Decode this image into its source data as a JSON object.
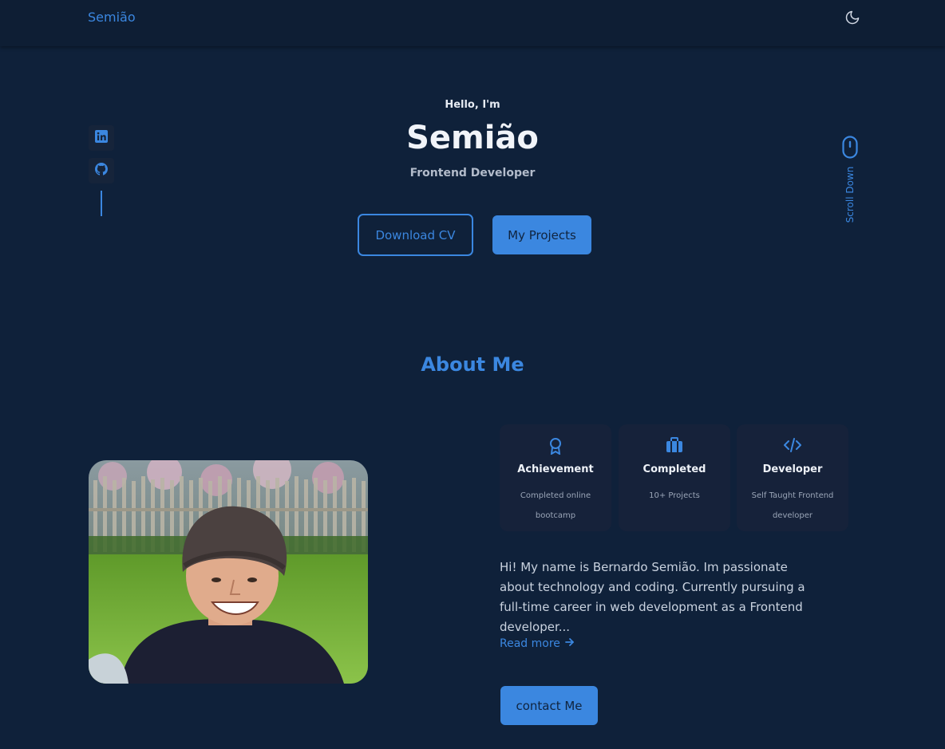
{
  "header": {
    "brand": "Semião",
    "theme_icon": "moon-icon"
  },
  "social": {
    "items": [
      {
        "icon": "linkedin-icon"
      },
      {
        "icon": "github-icon"
      }
    ]
  },
  "hero": {
    "greeting": "Hello, I'm",
    "name": "Semião",
    "role": "Frontend Developer",
    "download_label": "Download CV",
    "projects_label": "My Projects",
    "scroll_label": "Scroll Down"
  },
  "about": {
    "title": "About Me",
    "cards": [
      {
        "icon": "award-icon",
        "title": "Achievement",
        "subtitle": "Completed online bootcamp"
      },
      {
        "icon": "briefcase-icon",
        "title": "Completed",
        "subtitle": "10+ Projects"
      },
      {
        "icon": "code-icon",
        "title": "Developer",
        "subtitle": "Self Taught Frontend developer"
      }
    ],
    "bio": "Hi! My name is Bernardo Semião. Im passionate about technology and coding. Currently pursuing a full-time career in web development as a Frontend developer...",
    "read_more": "Read more",
    "contact_label": "contact Me"
  },
  "colors": {
    "background": "#0f213a",
    "header": "#0e1e34",
    "accent": "#3b87e0",
    "card": "#16223a"
  }
}
